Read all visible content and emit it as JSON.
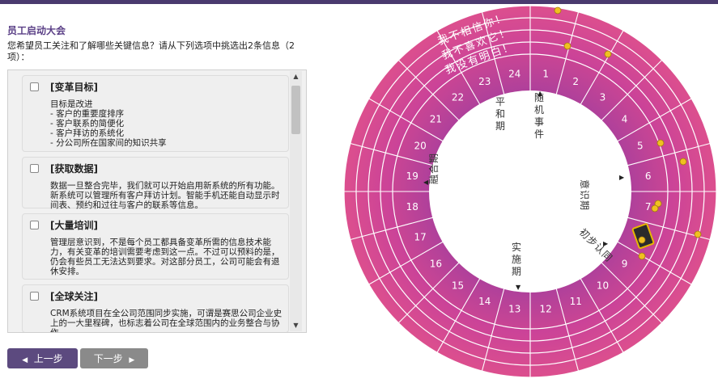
{
  "page": {
    "title": "员工启动大会",
    "prompt": "您希望员工关注和了解哪些关键信息？请从下列选项中挑选出2条信息（2项）："
  },
  "options": [
    {
      "title": "[变革目标]",
      "body": "目标是改进\n- 客户的重要度排序\n- 客户联系的简便化\n- 客户拜访的系统化\n- 分公司所在国家间的知识共享"
    },
    {
      "title": "[获取数据]",
      "body": "数据一旦整合完毕，我们就可以开始启用新系统的所有功能。新系统可以管理所有客户拜访计划。智能手机还能自动显示时间表、预约和过往与客户的联系等信息。"
    },
    {
      "title": "[大量培训]",
      "body": "管理层意识到，不是每个员工都具备变革所需的信息技术能力，有关变革的培训需要考虑到这一点。不过可以预料的是，仍会有些员工无法达到要求。对这部分员工，公司可能会有退休安排。"
    },
    {
      "title": "[全球关注]",
      "body": "CRM系统项目在全公司范围同步实施，可谓是赛思公司企业史上的一大里程碑，也标志着公司在全球范围内的业务整合与协作。"
    }
  ],
  "nav": {
    "prev": "上一步",
    "next": "下一步"
  },
  "wheel": {
    "outer_texts": [
      "我不相信你！",
      "我不喜欢它！",
      "我没有明白！"
    ],
    "numbers": [
      "1",
      "2",
      "3",
      "4",
      "5",
      "6",
      "7",
      "8",
      "9",
      "10",
      "11",
      "12",
      "13",
      "14",
      "15",
      "16",
      "17",
      "18",
      "19",
      "20",
      "21",
      "22",
      "23",
      "24"
    ],
    "phases": [
      "随机事件",
      "意识期",
      "初步认同",
      "实施期",
      "融合期",
      "平和期"
    ],
    "colors": {
      "outer": "#dc4f8e",
      "mid": "#c94594",
      "inner": "#9d3d9f",
      "line": "#ffffff"
    }
  }
}
